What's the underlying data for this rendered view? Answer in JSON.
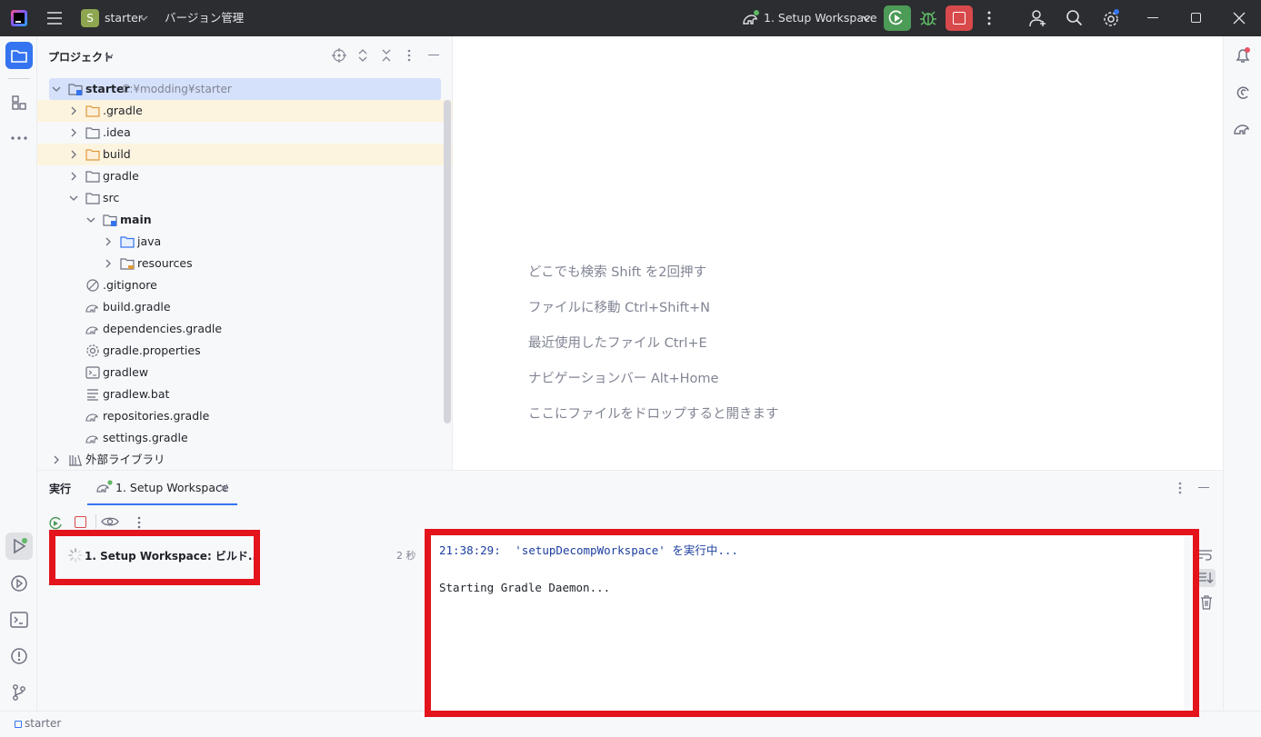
{
  "titlebar": {
    "project_badge": "S",
    "project_name": "starter",
    "vcs_label": "バージョン管理",
    "run_config": "1. Setup Workspace",
    "colors": {
      "run_green": "#4c9b57",
      "stop_red": "#d8494b",
      "badge": "#8ea64f"
    }
  },
  "project_panel": {
    "title": "プロジェクト",
    "tree": [
      {
        "label": "starter",
        "path": "C:¥modding¥starter",
        "bold": true
      },
      {
        "label": ".gradle"
      },
      {
        "label": ".idea"
      },
      {
        "label": "build"
      },
      {
        "label": "gradle"
      },
      {
        "label": "src"
      },
      {
        "label": "main",
        "bold": true
      },
      {
        "label": "java"
      },
      {
        "label": "resources"
      },
      {
        "label": ".gitignore"
      },
      {
        "label": "build.gradle"
      },
      {
        "label": "dependencies.gradle"
      },
      {
        "label": "gradle.properties"
      },
      {
        "label": "gradlew"
      },
      {
        "label": "gradlew.bat"
      },
      {
        "label": "repositories.gradle"
      },
      {
        "label": "settings.gradle"
      },
      {
        "label": "外部ライブラリ"
      }
    ]
  },
  "editor": {
    "hints": [
      "どこでも検索 Shift を2回押す",
      "ファイルに移動 Ctrl+Shift+N",
      "最近使用したファイル Ctrl+E",
      "ナビゲーションバー Alt+Home",
      "ここにファイルをドロップすると開きます"
    ]
  },
  "run_panel": {
    "label": "実行",
    "tab": "1. Setup Workspace",
    "task_label": "1. Setup Workspace: ビルド...",
    "task_time": "2 秒",
    "console": {
      "time": "21:38:29:",
      "command": "'setupDecompWorkspace'",
      "suffix": "を実行中...",
      "line2": "Starting Gradle Daemon..."
    }
  },
  "statusbar": {
    "project": "starter"
  }
}
